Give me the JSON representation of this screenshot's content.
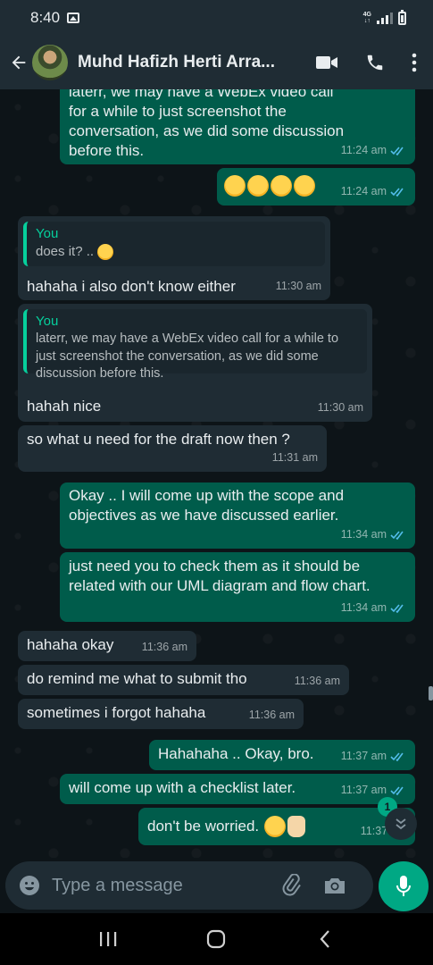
{
  "status_bar": {
    "time": "8:40",
    "network": "4G",
    "network_sub": "↓↑"
  },
  "header": {
    "contact_name": "Muhd Hafizh Herti Arra..."
  },
  "messages": [
    {
      "dir": "out",
      "text": "laterr, we may have a WebEx video call for a while to just screenshot the conversation, as we did some discussion before this.",
      "time": "11:24 am"
    },
    {
      "dir": "out",
      "emojis": [
        "rolling-on-floor-laughing",
        "rolling-on-floor-laughing",
        "rolling-on-floor-laughing",
        "rolling-on-floor-laughing"
      ],
      "time": "11:24 am"
    },
    {
      "dir": "in",
      "quote_author": "You",
      "quote_text": "does it? ..",
      "quote_emoji": "flushed-face",
      "text": "hahaha i also don't know either",
      "time": "11:30 am"
    },
    {
      "dir": "in",
      "quote_author": "You",
      "quote_text": "laterr, we may have a WebEx video call for a while to just screenshot the conversation, as we did some discussion before this.",
      "text": "hahah nice",
      "time": "11:30 am"
    },
    {
      "dir": "in",
      "text": "so what u need for the draft now then ?",
      "time": "11:31 am"
    },
    {
      "dir": "out",
      "text": "Okay .. I will come up with the scope and objectives as we have discussed earlier.",
      "time": "11:34 am"
    },
    {
      "dir": "out",
      "text": "just need you to check them as it should be related with our UML diagram and flow chart.",
      "time": "11:34 am"
    },
    {
      "dir": "in",
      "text": "hahaha okay",
      "time": "11:36 am"
    },
    {
      "dir": "in",
      "text": "do remind me what to submit tho",
      "time": "11:36 am"
    },
    {
      "dir": "in",
      "text": "sometimes i forgot hahaha",
      "time": "11:36 am"
    },
    {
      "dir": "out",
      "text": "Hahahaha .. Okay, bro.",
      "time": "11:37 am"
    },
    {
      "dir": "out",
      "text": "will come up with a checklist later.",
      "time": "11:37 am"
    },
    {
      "dir": "out",
      "text": "don't be worried.",
      "emojis": [
        "zany-face",
        "victory-hand"
      ],
      "time": "11:37 am"
    }
  ],
  "unread_count": "1",
  "composer": {
    "placeholder": "Type a message"
  },
  "colors": {
    "incoming": "#1f2c34",
    "outgoing": "#005c4b",
    "accent": "#00a884",
    "read_ticks": "#53bdeb"
  }
}
